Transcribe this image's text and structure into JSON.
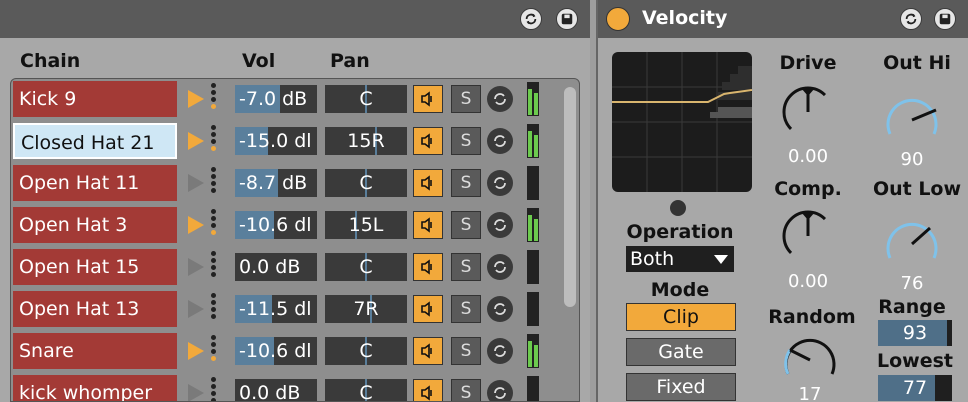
{
  "chain_panel": {
    "columns": {
      "chain": "Chain",
      "vol": "Vol",
      "pan": "Pan"
    },
    "rows": [
      {
        "name": "Kick 9",
        "vol": "-7.0 dB",
        "vol_level": 0.55,
        "pan": "C",
        "pan_pos": 0.5,
        "playing": true,
        "selected": false,
        "solo": "S"
      },
      {
        "name": "Closed Hat 21",
        "vol": "-15.0 dl",
        "vol_level": 0.4,
        "pan": "15R",
        "pan_pos": 0.62,
        "playing": true,
        "selected": true,
        "solo": "S"
      },
      {
        "name": "Open Hat 11",
        "vol": "-8.7 dB",
        "vol_level": 0.52,
        "pan": "C",
        "pan_pos": 0.5,
        "playing": false,
        "selected": false,
        "solo": "S"
      },
      {
        "name": "Open Hat 3",
        "vol": "-10.6 dl",
        "vol_level": 0.47,
        "pan": "15L",
        "pan_pos": 0.38,
        "playing": true,
        "selected": false,
        "solo": "S"
      },
      {
        "name": "Open Hat 15",
        "vol": "0.0 dB",
        "vol_level": 0.0,
        "pan": "C",
        "pan_pos": 0.5,
        "playing": false,
        "selected": false,
        "solo": "S"
      },
      {
        "name": "Open Hat 13",
        "vol": "-11.5 dl",
        "vol_level": 0.45,
        "pan": "7R",
        "pan_pos": 0.56,
        "playing": false,
        "selected": false,
        "solo": "S"
      },
      {
        "name": "Snare",
        "vol": "-10.6 dl",
        "vol_level": 0.47,
        "pan": "C",
        "pan_pos": 0.5,
        "playing": true,
        "selected": false,
        "solo": "S"
      },
      {
        "name": "kick whomper",
        "vol": "0.0 dB",
        "vol_level": 0.0,
        "pan": "C",
        "pan_pos": 0.5,
        "playing": false,
        "selected": false,
        "solo": "S"
      }
    ]
  },
  "velocity": {
    "title": "Velocity",
    "operation_label": "Operation",
    "operation_value": "Both",
    "mode_label": "Mode",
    "modes": [
      "Clip",
      "Gate",
      "Fixed"
    ],
    "active_mode": "Clip",
    "drive": {
      "label": "Drive",
      "value": "0.00"
    },
    "comp": {
      "label": "Comp.",
      "value": "0.00"
    },
    "random": {
      "label": "Random",
      "value": "17"
    },
    "out_hi": {
      "label": "Out Hi",
      "value": "90"
    },
    "out_low": {
      "label": "Out Low",
      "value": "76"
    },
    "range": {
      "label": "Range",
      "value": "93"
    },
    "lowest": {
      "label": "Lowest",
      "value": "77"
    }
  },
  "colors": {
    "chain_red": "#a33a36",
    "selected_blue": "#cfe7f5",
    "accent_orange": "#f2a93b",
    "knob_blue": "#7fc2ea"
  }
}
